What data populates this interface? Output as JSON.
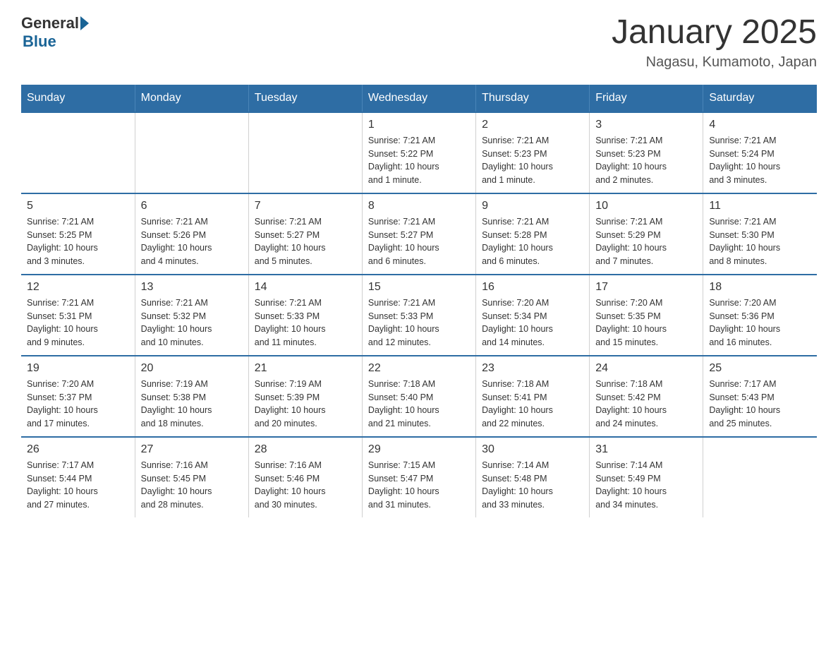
{
  "header": {
    "logo_general": "General",
    "logo_blue": "Blue",
    "title": "January 2025",
    "subtitle": "Nagasu, Kumamoto, Japan"
  },
  "days_of_week": [
    "Sunday",
    "Monday",
    "Tuesday",
    "Wednesday",
    "Thursday",
    "Friday",
    "Saturday"
  ],
  "weeks": [
    [
      {
        "day": "",
        "info": ""
      },
      {
        "day": "",
        "info": ""
      },
      {
        "day": "",
        "info": ""
      },
      {
        "day": "1",
        "info": "Sunrise: 7:21 AM\nSunset: 5:22 PM\nDaylight: 10 hours\nand 1 minute."
      },
      {
        "day": "2",
        "info": "Sunrise: 7:21 AM\nSunset: 5:23 PM\nDaylight: 10 hours\nand 1 minute."
      },
      {
        "day": "3",
        "info": "Sunrise: 7:21 AM\nSunset: 5:23 PM\nDaylight: 10 hours\nand 2 minutes."
      },
      {
        "day": "4",
        "info": "Sunrise: 7:21 AM\nSunset: 5:24 PM\nDaylight: 10 hours\nand 3 minutes."
      }
    ],
    [
      {
        "day": "5",
        "info": "Sunrise: 7:21 AM\nSunset: 5:25 PM\nDaylight: 10 hours\nand 3 minutes."
      },
      {
        "day": "6",
        "info": "Sunrise: 7:21 AM\nSunset: 5:26 PM\nDaylight: 10 hours\nand 4 minutes."
      },
      {
        "day": "7",
        "info": "Sunrise: 7:21 AM\nSunset: 5:27 PM\nDaylight: 10 hours\nand 5 minutes."
      },
      {
        "day": "8",
        "info": "Sunrise: 7:21 AM\nSunset: 5:27 PM\nDaylight: 10 hours\nand 6 minutes."
      },
      {
        "day": "9",
        "info": "Sunrise: 7:21 AM\nSunset: 5:28 PM\nDaylight: 10 hours\nand 6 minutes."
      },
      {
        "day": "10",
        "info": "Sunrise: 7:21 AM\nSunset: 5:29 PM\nDaylight: 10 hours\nand 7 minutes."
      },
      {
        "day": "11",
        "info": "Sunrise: 7:21 AM\nSunset: 5:30 PM\nDaylight: 10 hours\nand 8 minutes."
      }
    ],
    [
      {
        "day": "12",
        "info": "Sunrise: 7:21 AM\nSunset: 5:31 PM\nDaylight: 10 hours\nand 9 minutes."
      },
      {
        "day": "13",
        "info": "Sunrise: 7:21 AM\nSunset: 5:32 PM\nDaylight: 10 hours\nand 10 minutes."
      },
      {
        "day": "14",
        "info": "Sunrise: 7:21 AM\nSunset: 5:33 PM\nDaylight: 10 hours\nand 11 minutes."
      },
      {
        "day": "15",
        "info": "Sunrise: 7:21 AM\nSunset: 5:33 PM\nDaylight: 10 hours\nand 12 minutes."
      },
      {
        "day": "16",
        "info": "Sunrise: 7:20 AM\nSunset: 5:34 PM\nDaylight: 10 hours\nand 14 minutes."
      },
      {
        "day": "17",
        "info": "Sunrise: 7:20 AM\nSunset: 5:35 PM\nDaylight: 10 hours\nand 15 minutes."
      },
      {
        "day": "18",
        "info": "Sunrise: 7:20 AM\nSunset: 5:36 PM\nDaylight: 10 hours\nand 16 minutes."
      }
    ],
    [
      {
        "day": "19",
        "info": "Sunrise: 7:20 AM\nSunset: 5:37 PM\nDaylight: 10 hours\nand 17 minutes."
      },
      {
        "day": "20",
        "info": "Sunrise: 7:19 AM\nSunset: 5:38 PM\nDaylight: 10 hours\nand 18 minutes."
      },
      {
        "day": "21",
        "info": "Sunrise: 7:19 AM\nSunset: 5:39 PM\nDaylight: 10 hours\nand 20 minutes."
      },
      {
        "day": "22",
        "info": "Sunrise: 7:18 AM\nSunset: 5:40 PM\nDaylight: 10 hours\nand 21 minutes."
      },
      {
        "day": "23",
        "info": "Sunrise: 7:18 AM\nSunset: 5:41 PM\nDaylight: 10 hours\nand 22 minutes."
      },
      {
        "day": "24",
        "info": "Sunrise: 7:18 AM\nSunset: 5:42 PM\nDaylight: 10 hours\nand 24 minutes."
      },
      {
        "day": "25",
        "info": "Sunrise: 7:17 AM\nSunset: 5:43 PM\nDaylight: 10 hours\nand 25 minutes."
      }
    ],
    [
      {
        "day": "26",
        "info": "Sunrise: 7:17 AM\nSunset: 5:44 PM\nDaylight: 10 hours\nand 27 minutes."
      },
      {
        "day": "27",
        "info": "Sunrise: 7:16 AM\nSunset: 5:45 PM\nDaylight: 10 hours\nand 28 minutes."
      },
      {
        "day": "28",
        "info": "Sunrise: 7:16 AM\nSunset: 5:46 PM\nDaylight: 10 hours\nand 30 minutes."
      },
      {
        "day": "29",
        "info": "Sunrise: 7:15 AM\nSunset: 5:47 PM\nDaylight: 10 hours\nand 31 minutes."
      },
      {
        "day": "30",
        "info": "Sunrise: 7:14 AM\nSunset: 5:48 PM\nDaylight: 10 hours\nand 33 minutes."
      },
      {
        "day": "31",
        "info": "Sunrise: 7:14 AM\nSunset: 5:49 PM\nDaylight: 10 hours\nand 34 minutes."
      },
      {
        "day": "",
        "info": ""
      }
    ]
  ]
}
